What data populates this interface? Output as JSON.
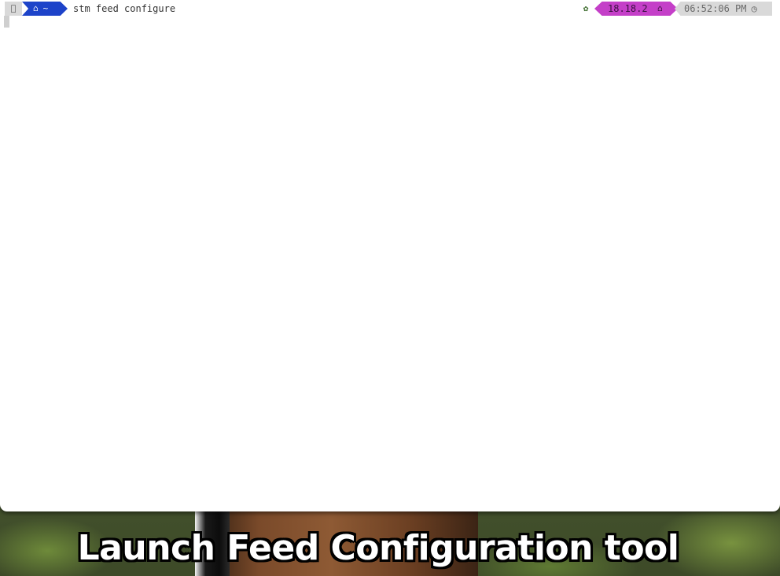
{
  "terminal": {
    "prompt": {
      "apple_icon": "apple-icon",
      "home_icon": "home-icon",
      "directory": "~",
      "command": "stm feed configure"
    },
    "status": {
      "leaf_icon": "leaf-icon",
      "node_version": "18.18.2",
      "node_icon": "node-icon",
      "time": "06:52:06 PM",
      "clock_icon": "clock-icon",
      "colors": {
        "home_segment": "#1d43c9",
        "version_segment": "#c43fc8",
        "neutral_segment": "#d9d9d9"
      }
    }
  },
  "caption": {
    "text": "Launch Feed Configuration tool"
  }
}
